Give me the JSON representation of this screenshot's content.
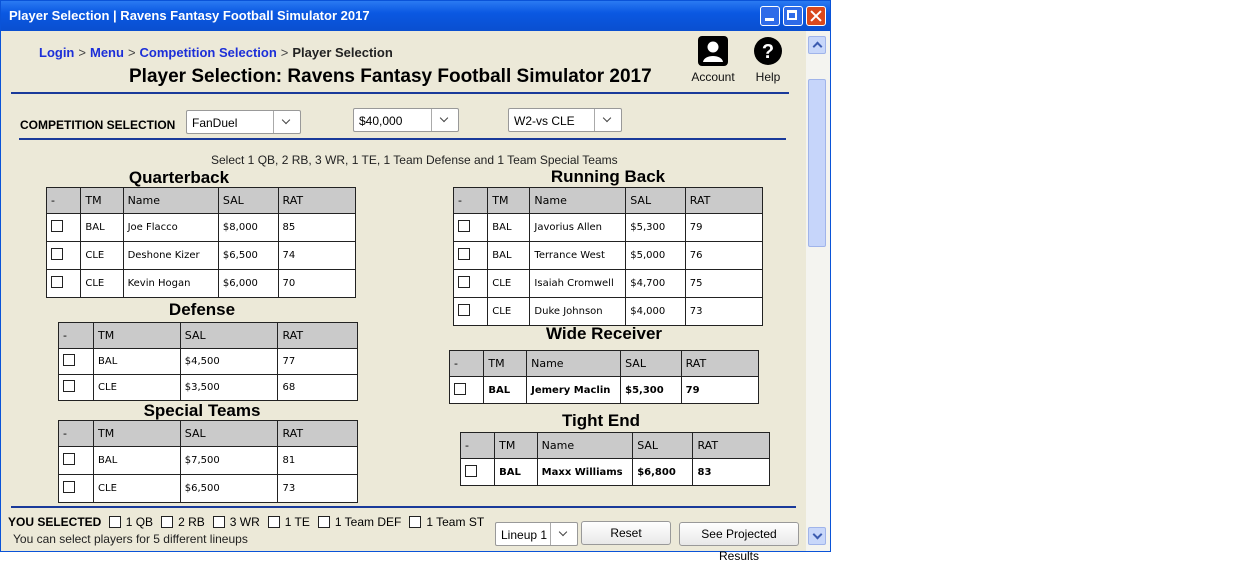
{
  "window": {
    "title": "Player Selection | Ravens Fantasy Football Simulator 2017"
  },
  "breadcrumb": {
    "login": "Login",
    "menu": "Menu",
    "competition": "Competition Selection",
    "current": "Player Selection",
    "sep": ">"
  },
  "page_title": "Player Selection: Ravens Fantasy Football Simulator 2017",
  "header": {
    "account_label": "Account",
    "help_label": "Help"
  },
  "competition": {
    "label": "COMPETITION SELECTION",
    "site": "FanDuel",
    "budget": "$40,000",
    "week": "W2-vs CLE"
  },
  "instructions": "Select 1 QB, 2 RB, 3 WR,  1 TE, 1 Team Defense and 1 Team Special Teams",
  "qb": {
    "title": "Quarterback",
    "headers": [
      "-",
      "TM",
      "Name",
      "SAL",
      "RAT"
    ],
    "rows": [
      {
        "tm": "BAL",
        "name": "Joe Flacco",
        "sal": "$8,000",
        "rat": "85"
      },
      {
        "tm": "CLE",
        "name": "Deshone Kizer",
        "sal": "$6,500",
        "rat": "74"
      },
      {
        "tm": "CLE",
        "name": "Kevin Hogan",
        "sal": "$6,000",
        "rat": "70"
      }
    ]
  },
  "defense": {
    "title": "Defense",
    "headers": [
      "-",
      "TM",
      "SAL",
      "RAT"
    ],
    "rows": [
      {
        "tm": "BAL",
        "sal": "$4,500",
        "rat": "77"
      },
      {
        "tm": "CLE",
        "sal": "$3,500",
        "rat": "68"
      }
    ]
  },
  "special_teams": {
    "title": "Special Teams",
    "headers": [
      "-",
      "TM",
      "SAL",
      "RAT"
    ],
    "rows": [
      {
        "tm": "BAL",
        "sal": "$7,500",
        "rat": "81"
      },
      {
        "tm": "CLE",
        "sal": "$6,500",
        "rat": "73"
      }
    ]
  },
  "rb": {
    "title": "Running Back",
    "headers": [
      "-",
      "TM",
      "Name",
      "SAL",
      "RAT"
    ],
    "rows": [
      {
        "tm": "BAL",
        "name": "Javorius Allen",
        "sal": "$5,300",
        "rat": "79"
      },
      {
        "tm": "BAL",
        "name": "Terrance West",
        "sal": "$5,000",
        "rat": "76"
      },
      {
        "tm": "CLE",
        "name": "Isaiah Cromwell",
        "sal": "$4,700",
        "rat": "75"
      },
      {
        "tm": "CLE",
        "name": "Duke Johnson",
        "sal": "$4,000",
        "rat": "73"
      }
    ]
  },
  "wr": {
    "title": "Wide Receiver",
    "headers": [
      "-",
      "TM",
      "Name",
      "SAL",
      "RAT"
    ],
    "rows": [
      {
        "tm": "BAL",
        "name": "Jemery Maclin",
        "sal": "$5,300",
        "rat": "79"
      }
    ]
  },
  "te": {
    "title": "Tight End",
    "headers": [
      "-",
      "TM",
      "Name",
      "SAL",
      "RAT"
    ],
    "rows": [
      {
        "tm": "BAL",
        "name": "Maxx Williams",
        "sal": "$6,800",
        "rat": "83"
      }
    ]
  },
  "selected": {
    "label": "YOU SELECTED",
    "items": [
      "1 QB",
      "2 RB",
      "3 WR",
      "1 TE",
      "1 Team DEF",
      "1 Team ST"
    ],
    "note": "You can select players for 5 different lineups",
    "lineup": "Lineup 1",
    "reset_label": "Reset",
    "results_label": "See Projected Results"
  }
}
